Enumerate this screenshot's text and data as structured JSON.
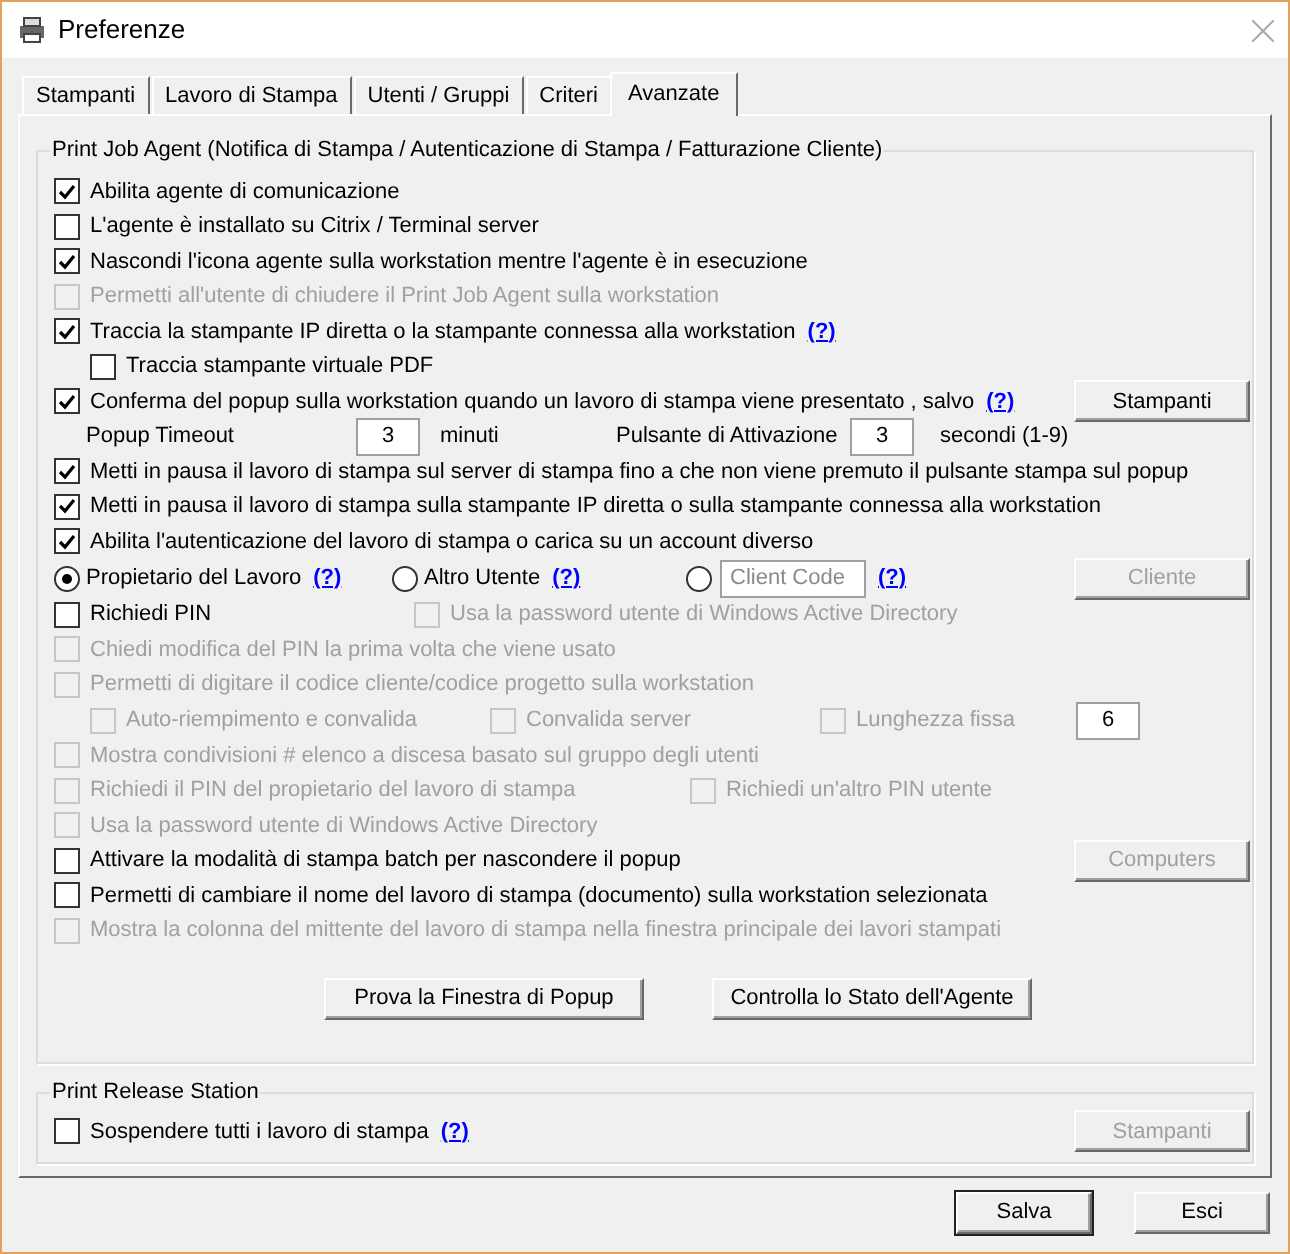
{
  "window": {
    "title": "Preferenze"
  },
  "tabs": [
    {
      "label": "Stampanti",
      "selected": false
    },
    {
      "label": "Lavoro di Stampa",
      "selected": false
    },
    {
      "label": "Utenti / Gruppi",
      "selected": false
    },
    {
      "label": "Criteri",
      "selected": false
    },
    {
      "label": "Avanzate",
      "selected": true
    }
  ],
  "agent": {
    "title": "Print Job Agent (Notifica di Stampa / Autenticazione di Stampa / Fatturazione Cliente)",
    "rows": [
      {
        "kind": "check",
        "label": "Abilita agente di comunicazione",
        "checked": true,
        "disabled": false
      },
      {
        "kind": "check",
        "label": "L'agente è installato su Citrix / Terminal server",
        "checked": false,
        "disabled": false
      },
      {
        "kind": "check",
        "label": "Nascondi l'icona agente sulla workstation mentre l'agente è in esecuzione",
        "checked": true,
        "disabled": false
      },
      {
        "kind": "check",
        "label": "Permetti all'utente di chiudere il Print Job Agent sulla workstation",
        "checked": false,
        "disabled": true
      },
      {
        "kind": "check",
        "label": "Traccia la stampante IP diretta o la stampante connessa alla workstation",
        "checked": true,
        "disabled": false,
        "help": "(?)",
        "children": [
          {
            "kind": "check",
            "label": "Traccia stampante virtuale PDF",
            "checked": false,
            "disabled": false
          }
        ]
      },
      {
        "kind": "check",
        "label": "Conferma del popup sulla workstation quando un lavoro di stampa viene presentato , salvo",
        "checked": true,
        "disabled": false,
        "help": "(?)",
        "button": {
          "label": "Stampanti",
          "disabled": false
        }
      },
      {
        "kind": "timeouts",
        "timeout_label": "Popup Timeout",
        "timeout_value": "3",
        "timeout_unit": "minuti",
        "activation_label": "Pulsante di Attivazione",
        "activation_value": "3",
        "activation_unit": "secondi (1-9)"
      },
      {
        "kind": "check",
        "label": "Metti in pausa il lavoro di stampa sul server di stampa fino a che non viene premuto il pulsante stampa sul popup",
        "checked": true,
        "disabled": false
      },
      {
        "kind": "check",
        "label": "Metti in pausa il lavoro di stampa sulla stampante IP diretta o sulla stampante connessa alla workstation",
        "checked": true,
        "disabled": false
      },
      {
        "kind": "check",
        "label": "Abilita l'autenticazione del lavoro di stampa o carica su un account diverso",
        "checked": true,
        "disabled": false
      },
      {
        "kind": "radios",
        "options": [
          {
            "label": "Propietario del Lavoro",
            "selected": true,
            "help": "(?)"
          },
          {
            "label": "Altro Utente",
            "selected": false,
            "help": "(?)"
          },
          {
            "placeholder": "Client Code",
            "selected": false,
            "help": "(?)"
          }
        ],
        "button": {
          "label": "Cliente",
          "disabled": true
        }
      },
      {
        "kind": "pair",
        "wide": false,
        "label": "Richiedi PIN",
        "checked": false,
        "disabled": false,
        "side": {
          "label": "Usa la password utente di Windows Active Directory",
          "checked": false,
          "disabled": true
        }
      },
      {
        "kind": "check",
        "label": "Chiedi modifica del PIN la prima volta che viene usato",
        "checked": false,
        "disabled": true
      },
      {
        "kind": "check",
        "label": "Permetti di digitare il codice cliente/codice progetto sulla workstation",
        "checked": false,
        "disabled": true,
        "children": [
          {
            "kind": "client_options",
            "options": [
              {
                "label": "Auto-riempimento e convalida",
                "checked": false,
                "disabled": true
              },
              {
                "label": "Convalida server",
                "checked": false,
                "disabled": true
              },
              {
                "label": "Lunghezza fissa",
                "checked": false,
                "disabled": true
              }
            ],
            "length_value": "6"
          }
        ]
      },
      {
        "kind": "check",
        "label": "Mostra condivisioni # elenco a discesa basato sul gruppo degli utenti",
        "checked": false,
        "disabled": true
      },
      {
        "kind": "pair",
        "wide": true,
        "label": "Richiedi il PIN del propietario del lavoro di stampa",
        "checked": false,
        "disabled": true,
        "side": {
          "label": "Richiedi un'altro PIN utente",
          "checked": false,
          "disabled": true
        }
      },
      {
        "kind": "check",
        "label": "Usa la password utente di Windows Active Directory",
        "checked": false,
        "disabled": true
      },
      {
        "kind": "check",
        "label": "Attivare la modalità di stampa batch per nascondere il popup",
        "checked": false,
        "disabled": false,
        "button": {
          "label": "Computers",
          "disabled": true
        }
      },
      {
        "kind": "check",
        "label": "Permetti di cambiare il nome del lavoro di stampa (documento) sulla workstation selezionata",
        "checked": false,
        "disabled": false
      },
      {
        "kind": "check",
        "label": "Mostra la colonna del mittente del lavoro di stampa nella finestra principale dei lavori stampati",
        "checked": false,
        "disabled": true
      }
    ],
    "buttons": [
      {
        "label": "Prova la Finestra di Popup"
      },
      {
        "label": "Controlla lo Stato dell'Agente"
      }
    ]
  },
  "release": {
    "title": "Print Release Station",
    "row": {
      "kind": "check",
      "label": "Sospendere tutti i lavoro di stampa",
      "checked": false,
      "disabled": false,
      "help": "(?)",
      "button": {
        "label": "Stampanti",
        "disabled": true
      }
    }
  },
  "footer": [
    {
      "label": "Salva",
      "default": true
    },
    {
      "label": "Esci",
      "default": false
    }
  ]
}
